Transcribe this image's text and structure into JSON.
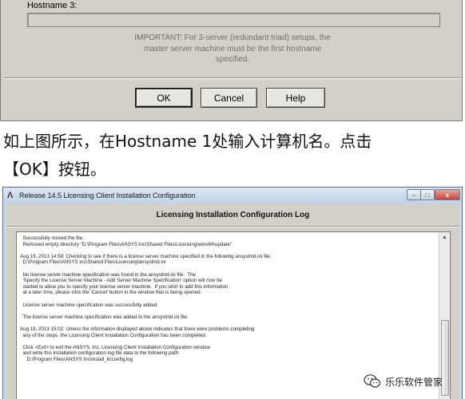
{
  "dialog1": {
    "hostname3_label": "Hostname 3:",
    "hostname3_value": "",
    "note_lines": [
      "IMPORTANT: For 3-server (redundant triad) setups, the",
      "master server machine must be the first hostname",
      "specified."
    ],
    "buttons": {
      "ok": "OK",
      "cancel": "Cancel",
      "help": "Help"
    }
  },
  "caption": {
    "line1": "如上图所示，在Hostname 1处输入计算机名。点击",
    "line2": "【OK】按钮。"
  },
  "window2": {
    "title": "Release 14.5 Licensing Client Installation Configuration",
    "controls": {
      "minimize": "–",
      "maximize": "□",
      "close": "x"
    },
    "header": "Licensing Installation Configuration Log",
    "log_lines": [
      "  Successfully moved the file.",
      "  Removed empty directory \"D:\\Program Files\\ANSYS Inc\\Shared Files\\Licensing\\winx64\\update\".",
      "",
      "Aug 19, 2013 14:58: Checking to see if there is a license server machine specified in the following ansyslmd.ini file:",
      "  D:\\Program Files\\ANSYS Inc\\Shared Files\\Licensing\\ansyslmd.ini",
      "",
      "  No license server machine specification was found in the ansyslmd.ini file.  The",
      "  'Specify the License Server Machine - Add Server Machine Specification' option will now be",
      "  started to allow you to specify your license server machine.  If you wish to add this information",
      "  at a later time, please click the 'Cancel' button in the window that is being opened.",
      "",
      "  License server machine specification was successfully added.",
      "",
      "  The license server machine specification was added to the ansyslmd.ini file.",
      "",
      "Aug 19, 2013 15:02: Unless the information displayed above indicates that there were problems completing",
      "  any of the steps, the Licensing Client Installation Configuration has been completed.",
      "",
      "  Click <Exit> to exit the ANSYS, Inc. Licensing Client Installation Configuration window",
      "  and write this installation configuration log file data to the following path:",
      "     D:\\Program Files\\ANSYS Inc\\install_licconfig.log"
    ]
  },
  "watermark": {
    "text": "乐乐软件管家",
    "icon": "wechat-icon"
  },
  "colors": {
    "dialog_bg": "#d4d0c8",
    "titlebar": "#c8d8e8",
    "note_text": "#6e6e6e"
  }
}
